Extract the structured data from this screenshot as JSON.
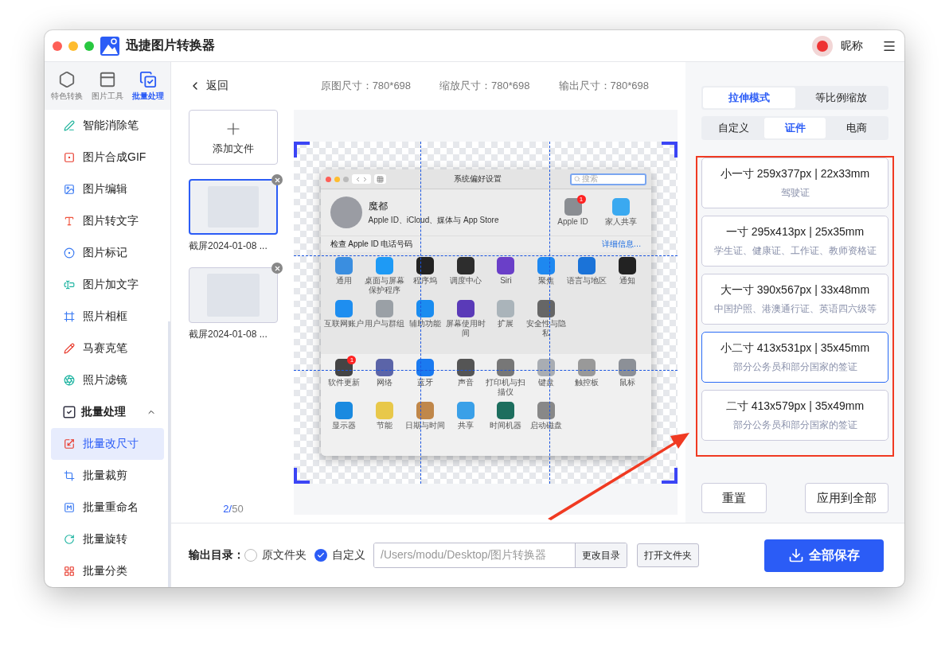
{
  "app": {
    "title": "迅捷图片转换器",
    "user": "昵称"
  },
  "nav_tabs": [
    {
      "label": "特色转换",
      "selected": false
    },
    {
      "label": "图片工具",
      "selected": false
    },
    {
      "label": "批量处理",
      "selected": true
    }
  ],
  "sidebar": {
    "items": [
      {
        "label": "智能消除笔",
        "selected": false
      },
      {
        "label": "图片合成GIF",
        "selected": false
      },
      {
        "label": "图片编辑",
        "selected": false
      },
      {
        "label": "图片转文字",
        "selected": false
      },
      {
        "label": "图片标记",
        "selected": false
      },
      {
        "label": "图片加文字",
        "selected": false
      },
      {
        "label": "照片相框",
        "selected": false
      },
      {
        "label": "马赛克笔",
        "selected": false
      },
      {
        "label": "照片滤镜",
        "selected": false
      }
    ],
    "group": {
      "label": "批量处理",
      "expanded": true,
      "children": [
        {
          "label": "批量改尺寸",
          "selected": true
        },
        {
          "label": "批量裁剪",
          "selected": false
        },
        {
          "label": "批量重命名",
          "selected": false
        },
        {
          "label": "批量旋转",
          "selected": false
        },
        {
          "label": "批量分类",
          "selected": false
        }
      ]
    }
  },
  "back": "返回",
  "sizes": [
    "原图尺寸：780*698",
    "缩放尺寸：780*698",
    "输出尺寸：780*698"
  ],
  "files": {
    "add_label": "添加文件",
    "items": [
      {
        "name": "截屏2024-01-08 ...",
        "selected": true
      },
      {
        "name": "截屏2024-01-08 ...",
        "selected": false
      }
    ],
    "current": "2/",
    "total": "50"
  },
  "preview": {
    "window_title": "系统偏好设置",
    "search_placeholder": "搜索",
    "user_name": "魔都",
    "user_sub": "Apple ID、iCloud、媒体与 App Store",
    "top_icons": [
      {
        "label": "Apple ID",
        "badge": "1"
      },
      {
        "label": "家人共享"
      }
    ],
    "notice": "检查 Apple ID 电话号码",
    "notice_link": "详细信息…",
    "sections": [
      {
        "items": [
          {
            "label": "通用"
          },
          {
            "label": "桌面与屏幕保护程序"
          },
          {
            "label": "程序坞"
          },
          {
            "label": "调度中心"
          },
          {
            "label": "Siri"
          },
          {
            "label": "聚焦"
          },
          {
            "label": "语言与地区"
          },
          {
            "label": "通知"
          },
          {
            "label": "互联网账户"
          },
          {
            "label": "用户与群组"
          },
          {
            "label": "辅助功能"
          },
          {
            "label": "屏幕使用时间"
          },
          {
            "label": "扩展"
          },
          {
            "label": "安全性与隐私"
          }
        ]
      },
      {
        "items": [
          {
            "label": "软件更新",
            "badge": "1"
          },
          {
            "label": "网络"
          },
          {
            "label": "蓝牙"
          },
          {
            "label": "声音"
          },
          {
            "label": "打印机与扫描仪"
          },
          {
            "label": "键盘"
          },
          {
            "label": "触控板"
          },
          {
            "label": "鼠标"
          },
          {
            "label": "显示器"
          },
          {
            "label": "节能"
          },
          {
            "label": "日期与时间"
          },
          {
            "label": "共享"
          },
          {
            "label": "时间机器"
          },
          {
            "label": "启动磁盘"
          }
        ]
      }
    ]
  },
  "mode_tabs": [
    {
      "label": "拉伸模式",
      "selected": true
    },
    {
      "label": "等比例缩放",
      "selected": false
    }
  ],
  "category_tabs": [
    {
      "label": "自定义",
      "selected": false
    },
    {
      "label": "证件",
      "selected": true
    },
    {
      "label": "电商",
      "selected": false
    }
  ],
  "presets": [
    {
      "title": "小一寸 259x377px | 22x33mm",
      "desc": "驾驶证",
      "selected": false
    },
    {
      "title": "一寸 295x413px | 25x35mm",
      "desc": "学生证、健康证、工作证、教师资格证",
      "selected": false
    },
    {
      "title": "大一寸 390x567px | 33x48mm",
      "desc": "中国护照、港澳通行证、英语四六级等",
      "selected": false
    },
    {
      "title": "小二寸 413x531px | 35x45mm",
      "desc": "部分公务员和部分国家的签证",
      "selected": true
    },
    {
      "title": "二寸 413x579px | 35x49mm",
      "desc": "部分公务员和部分国家的签证",
      "selected": false
    }
  ],
  "panel_buttons": [
    "重置",
    "应用到全部"
  ],
  "output": {
    "label": "输出目录：",
    "options": [
      {
        "label": "原文件夹",
        "selected": false
      },
      {
        "label": "自定义",
        "selected": true
      }
    ],
    "path": "/Users/modu/Desktop/图片转换器",
    "change_button": "更改目录",
    "open_button": "打开文件夹",
    "save_button": "全部保存"
  }
}
